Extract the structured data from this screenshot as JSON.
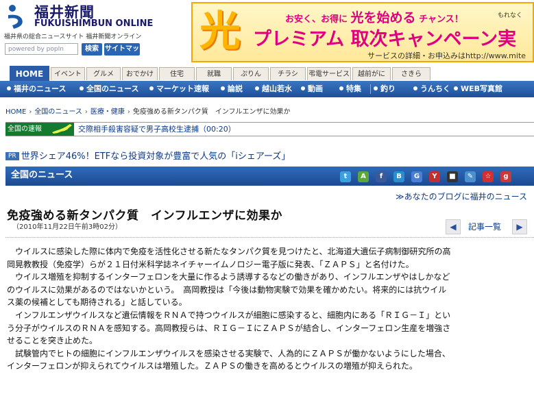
{
  "header": {
    "logo_jp": "福井新聞",
    "logo_en": "FUKUISHIMBUN ONLINE",
    "tagline": "福井県の総合ニュースサイト 福井新聞オンライン",
    "search_placeholder": "powered by popIn",
    "search_button": "検索",
    "sitemap_button": "サイトマップ"
  },
  "banner_ad": {
    "big_char": "光",
    "line1_a": "お安く、お得に",
    "line1_b": "光を始める",
    "line1_c": "チャンス！",
    "line1_end": "もれなく",
    "line2": "プレミアム 取次キャンペーン実",
    "line3": "サービスの詳細・お申込みはhttp://www.mite"
  },
  "tabs": [
    {
      "label": "HOME",
      "active": true
    },
    {
      "label": "イベント"
    },
    {
      "label": "グルメ"
    },
    {
      "label": "おでかけ"
    },
    {
      "label": "住宅"
    },
    {
      "label": "就職"
    },
    {
      "label": "ぷりん"
    },
    {
      "label": "チラシ"
    },
    {
      "label": "弔電サービス"
    },
    {
      "label": "越前がに"
    },
    {
      "label": "さきら"
    }
  ],
  "subnav": [
    {
      "label": "福井のニュース"
    },
    {
      "label": "全国のニュース"
    },
    {
      "label": "マーケット速報"
    },
    {
      "label": "論説"
    },
    {
      "label": "越山若水"
    },
    {
      "label": "動画"
    },
    {
      "label": "特集"
    },
    {
      "label": "釣り"
    },
    {
      "label": "うんちく"
    },
    {
      "label": "WEB写真館"
    }
  ],
  "breadcrumb": {
    "home": "HOME",
    "level1": "全国のニュース",
    "level2": "医療・健康",
    "current": "免疫強める新タンパク質　インフルエンザに効果か"
  },
  "flash": {
    "label": "全国の速報",
    "text": "交際相手殺害容疑で男子高校生逮捕（00:20）"
  },
  "pr": {
    "badge": "PR",
    "text": "世界シェア46%！ETFなら投資対象が豊富で人気の「iシェアーズ」"
  },
  "section": {
    "title": "全国のニュース"
  },
  "share_icons": [
    {
      "name": "twitter-icon",
      "glyph": "t",
      "color": "#3aa0e0"
    },
    {
      "name": "mixi-check-icon",
      "glyph": "A",
      "color": "#5aa83a"
    },
    {
      "name": "facebook-icon",
      "glyph": "f",
      "color": "#3b5998"
    },
    {
      "name": "hatena-bookmark-icon",
      "glyph": "B",
      "color": "#2a8fd0"
    },
    {
      "name": "google-icon",
      "glyph": "G",
      "color": "#4a7fd8"
    },
    {
      "name": "yahoo-bookmark-icon",
      "glyph": "Y",
      "color": "#c03030"
    },
    {
      "name": "delicious-icon",
      "glyph": "■",
      "color": "#333333"
    },
    {
      "name": "clip-icon",
      "glyph": "✎",
      "color": "#4a90d0"
    },
    {
      "name": "livedoor-clip-icon",
      "glyph": "☆",
      "color": "#d03030"
    },
    {
      "name": "goo-icon",
      "glyph": "g",
      "color": "#c83a3a"
    }
  ],
  "blog_link": "≫あなたのブログに福井のニュース",
  "article": {
    "headline": "免疫強める新タンパク質　インフルエンザに効果か",
    "dateline": "（2010年11月22日午前3時02分）",
    "nav_prev": "◀",
    "nav_index": "記事一覧",
    "nav_next": "▶",
    "lines": [
      "　ウイルスに感染した際に体内で免疫を活性化させる新たなタンパク質を見つけたと、北海道大遺伝子病制御研究所の高",
      "岡晃教教授（免疫学）らが２１日付米科学誌ネイチャーイムノロジー電子版に発表、「ＺＡＰＳ」と名付けた。",
      "　ウイルス増殖を抑制するインターフェロンを大量に作るよう誘導するなどの働きがあり、インフルエンザやはしかなど",
      "のウイルスに効果があるのではないかという。　高岡教授は「今後は動物実験で効果を確かめたい。将来的には抗ウイル",
      "ス薬の候補としても期待される」と話している。",
      "　インフルエンザウイルスなど遺伝情報をＲＮＡで持つウイルスが細胞に感染すると、細胞内にある「ＲＩＧ－Ｉ」とい",
      "う分子がウイルスのＲＮＡを感知する。高岡教授らは、ＲＩＧ－ＩにＺＡＰＳが結合し、インターフェロン生産を増強さ",
      "せることを突き止めた。",
      "　試験管内でヒトの細胞にインフルエンザウイルスを感染させる実験で、人為的にＺＡＰＳが働かないようにした場合、",
      "インターフェロンが抑えられてウイルスは増殖した。ＺＡＰＳの働きを高めるとウイルスの増殖が抑えられた。"
    ]
  }
}
